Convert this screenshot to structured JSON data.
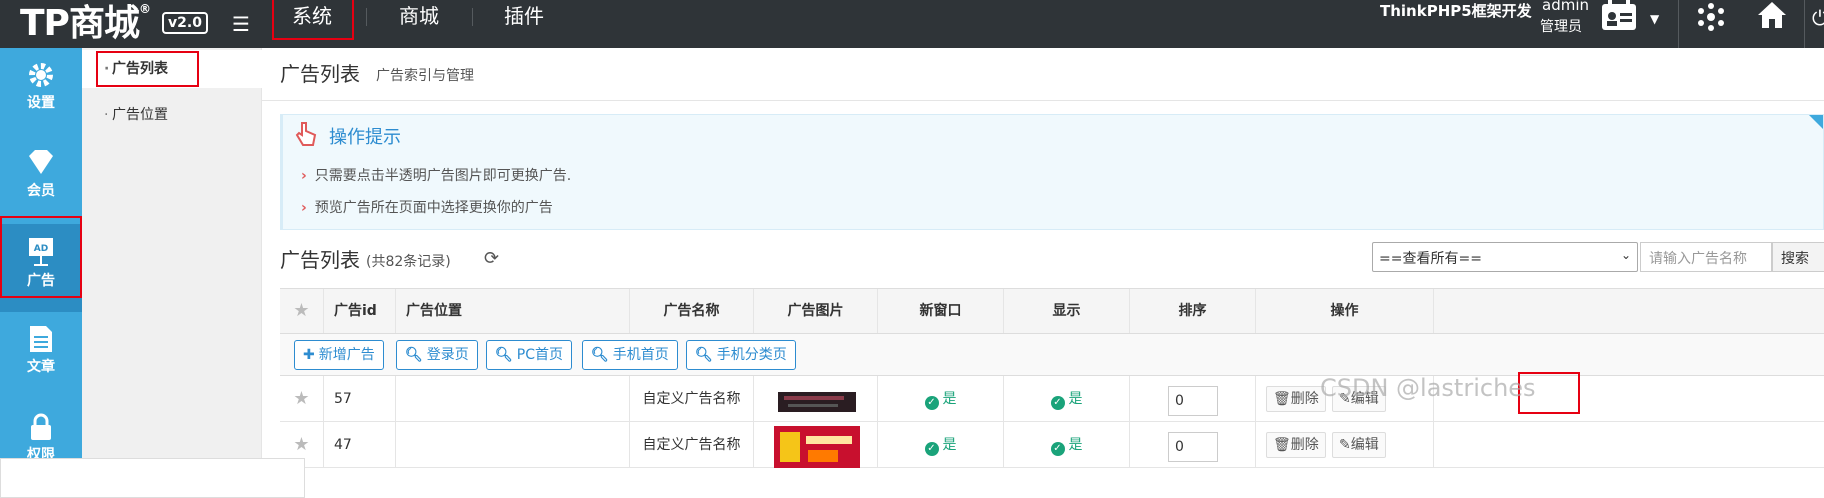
{
  "header": {
    "logo": "TP商城",
    "logo_reg": "®",
    "version": "v2.0",
    "nav": [
      "系统",
      "商城",
      "插件"
    ],
    "brand": "ThinkPHP5框架开发",
    "admin_name": "admin",
    "admin_role": "管理员"
  },
  "leftbar": {
    "items": [
      "设置",
      "会员",
      "广告",
      "文章",
      "权限"
    ]
  },
  "subnav": {
    "items": [
      "广告列表",
      "广告位置"
    ]
  },
  "page": {
    "title": "广告列表",
    "subtitle": "广告索引与管理"
  },
  "tips": {
    "title": "操作提示",
    "lines": [
      "只需要点击半透明广告图片即可更换广告.",
      "预览广告所在页面中选择更换你的广告"
    ]
  },
  "list": {
    "title": "广告列表",
    "count": "(共82条记录)",
    "filter_selected": "==查看所有==",
    "search_placeholder": "请输入广告名称",
    "search_button": "搜索"
  },
  "table": {
    "headers": [
      "广告id",
      "广告位置",
      "广告名称",
      "广告图片",
      "新窗口",
      "显示",
      "排序",
      "操作"
    ],
    "toolbar": [
      "新增广告",
      "登录页",
      "PC首页",
      "手机首页",
      "手机分类页"
    ],
    "rows": [
      {
        "id": "57",
        "position": "",
        "name": "自定义广告名称",
        "new_window": "是",
        "show": "是",
        "sort": "0",
        "delete": "删除",
        "edit": "编辑"
      },
      {
        "id": "47",
        "position": "",
        "name": "自定义广告名称",
        "new_window": "是",
        "show": "是",
        "sort": "0",
        "delete": "删除",
        "edit": "编辑"
      }
    ]
  },
  "watermark": "CSDN @lastriches",
  "colors": {
    "topbar": "#2f3438",
    "sidebar": "#3ea9dd",
    "accent": "#2d8cd0",
    "highlight": "#e60012",
    "yes": "#1aa37a"
  }
}
